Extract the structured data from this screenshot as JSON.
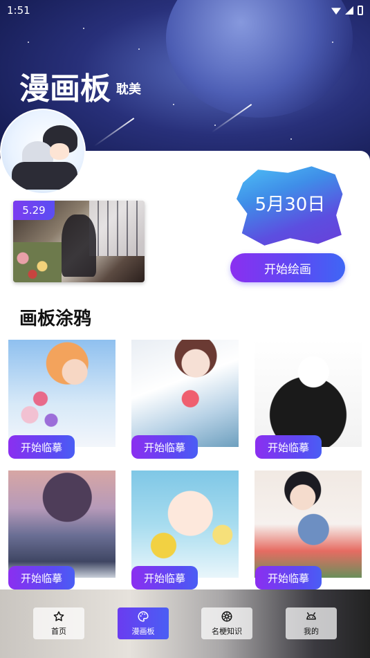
{
  "status_bar": {
    "time": "1:51"
  },
  "header": {
    "title": "漫画板",
    "subtitle": "耽美"
  },
  "featured": {
    "date_badge": "5.29"
  },
  "today": {
    "date": "5月30日",
    "button_label": "开始绘画"
  },
  "section": {
    "title": "画板涂鸦"
  },
  "gallery": {
    "items": [
      {
        "button_label": "开始临摹"
      },
      {
        "button_label": "开始临摹"
      },
      {
        "button_label": "开始临摹"
      },
      {
        "button_label": "开始临摹"
      },
      {
        "button_label": "开始临摹"
      },
      {
        "button_label": "开始临摹"
      }
    ]
  },
  "bottom_nav": {
    "active_index": 1,
    "items": [
      {
        "label": "首页",
        "icon": "star-icon"
      },
      {
        "label": "漫画板",
        "icon": "palette-icon"
      },
      {
        "label": "名梗知识",
        "icon": "aperture-icon"
      },
      {
        "label": "我的",
        "icon": "android-icon"
      }
    ]
  },
  "colors": {
    "accent_start": "#8b2ff0",
    "accent_end": "#4a5ef4",
    "header_bg": "#1f2a6b"
  }
}
